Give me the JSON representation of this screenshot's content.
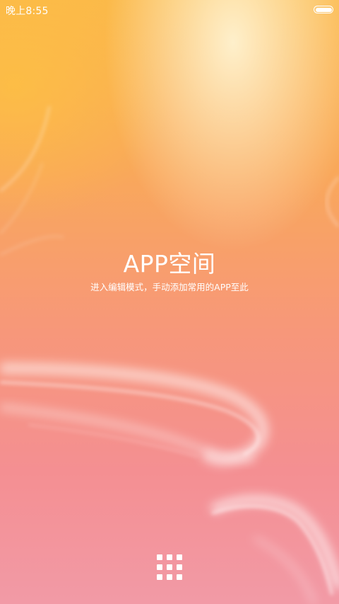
{
  "status_bar": {
    "time": "晚上8:55",
    "battery_level": 1.0,
    "battery_icon": "battery-icon"
  },
  "app_space": {
    "title": "APP空间",
    "subtitle": "进入编辑模式，手动添加常用的APP至此"
  },
  "dock": {
    "app_drawer_icon": "grid-icon"
  },
  "colors": {
    "text": "#ffffff",
    "gradient_top": "#fbb84a",
    "gradient_bottom": "#f29aa6"
  }
}
